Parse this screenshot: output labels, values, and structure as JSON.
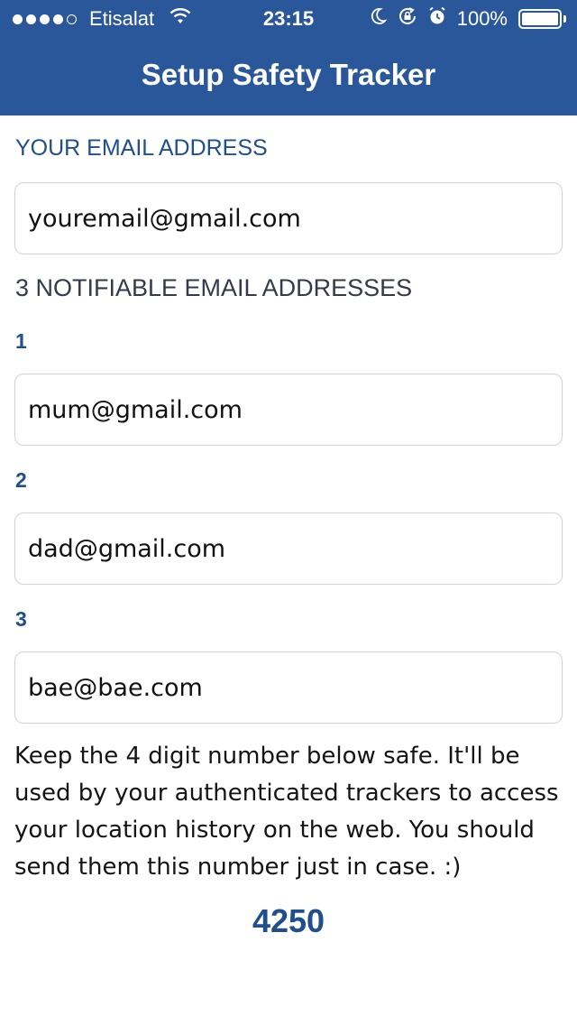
{
  "status_bar": {
    "signal_icon": "signal-dots-icon",
    "carrier": "Etisalat",
    "wifi_icon": "wifi-icon",
    "time": "23:15",
    "moon_icon": "moon-icon",
    "rotation_lock_icon": "rotation-lock-icon",
    "alarm_icon": "alarm-icon",
    "battery_percent": "100%",
    "battery_icon": "battery-icon"
  },
  "nav": {
    "title": "Setup Safety Tracker"
  },
  "form": {
    "your_email_label": "YOUR EMAIL ADDRESS",
    "your_email_value": "youremail@gmail.com",
    "notifiable_label": "3 NOTIFIABLE EMAIL ADDRESSES",
    "contacts": [
      {
        "number": "1",
        "email": "mum@gmail.com"
      },
      {
        "number": "2",
        "email": "dad@gmail.com"
      },
      {
        "number": "3",
        "email": "bae@bae.com"
      }
    ]
  },
  "info_text": "Keep the 4 digit number below safe. It'll be used by your authenticated trackers to access your location history on the web. You should send them this number just in case. :)",
  "pin_code": "4250",
  "colors": {
    "nav_background": "#2a579a",
    "accent_text": "#1f4f8c"
  }
}
